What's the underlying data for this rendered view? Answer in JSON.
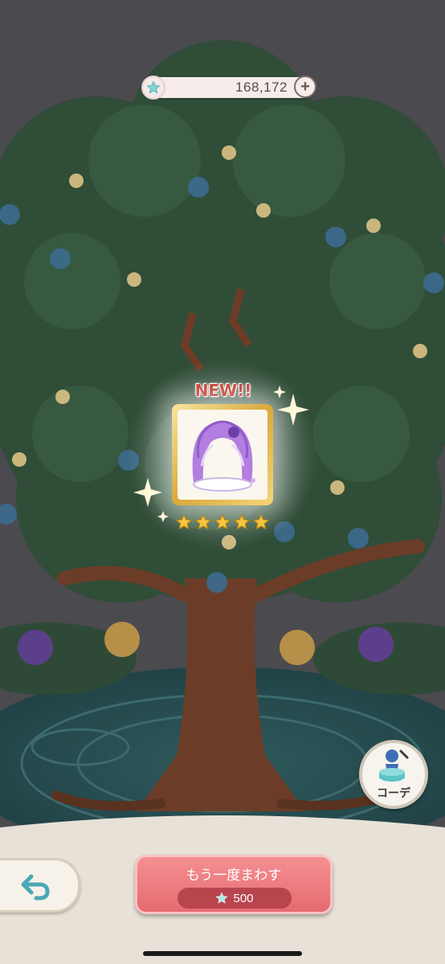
{
  "currency": {
    "icon": "star-icon",
    "amount": "168,172",
    "add_icon": "plus-icon",
    "add_label": "+"
  },
  "reward": {
    "badge": "NEW!!",
    "item_icon": "purple-hair-item-icon",
    "rarity_stars": 5
  },
  "coordinate_button": {
    "icon": "mannequin-icon",
    "label": "コーデ"
  },
  "back_button": {
    "icon": "back-arrow-icon"
  },
  "spin_again_button": {
    "label": "もう一度まわす",
    "cost_icon": "star-icon",
    "cost": "500"
  },
  "colors": {
    "accent_pink": "#e56b70",
    "gold": "#d9a93a",
    "teal": "#5ec3c4"
  }
}
